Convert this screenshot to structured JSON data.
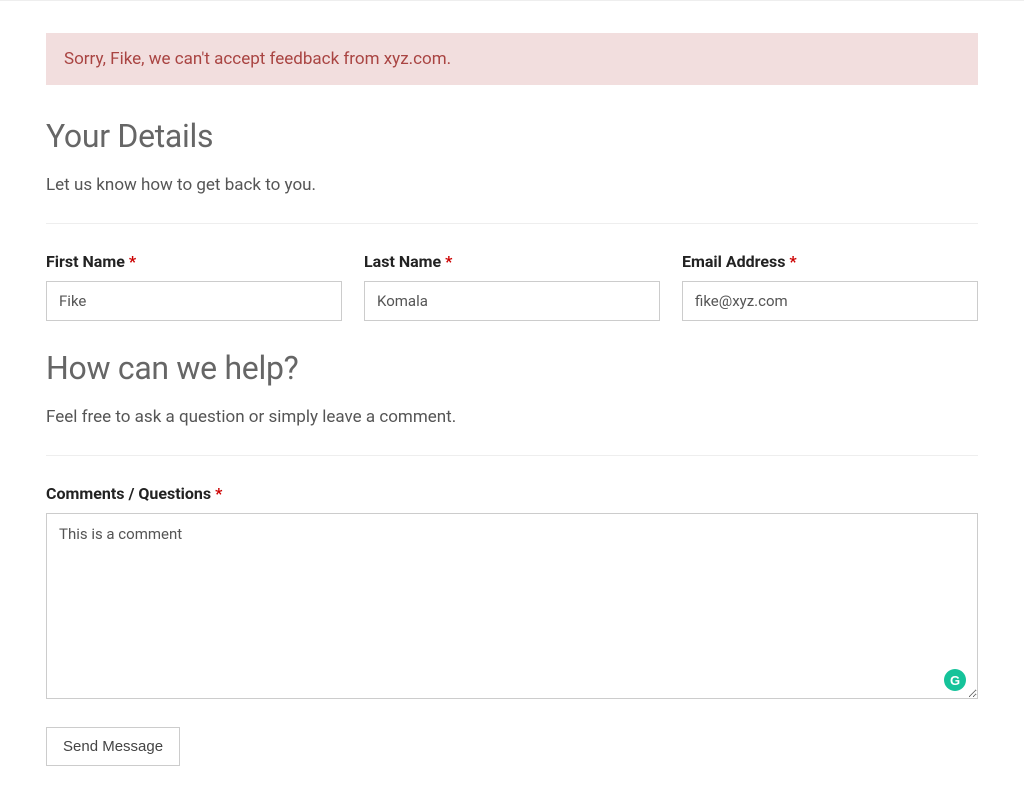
{
  "alert": {
    "message": "Sorry, Fike, we can't accept feedback from xyz.com."
  },
  "section1": {
    "title": "Your Details",
    "subtitle": "Let us know how to get back to you."
  },
  "fields": {
    "first_name": {
      "label": "First Name",
      "required": "*",
      "value": "Fike"
    },
    "last_name": {
      "label": "Last Name",
      "required": "*",
      "value": "Komala"
    },
    "email": {
      "label": "Email Address",
      "required": "*",
      "value": "fike@xyz.com"
    }
  },
  "section2": {
    "title": "How can we help?",
    "subtitle": "Feel free to ask a question or simply leave a comment."
  },
  "comments": {
    "label": "Comments / Questions",
    "required": "*",
    "value": "This is a comment"
  },
  "submit": {
    "label": "Send Message"
  },
  "badge": {
    "letter": "G"
  }
}
